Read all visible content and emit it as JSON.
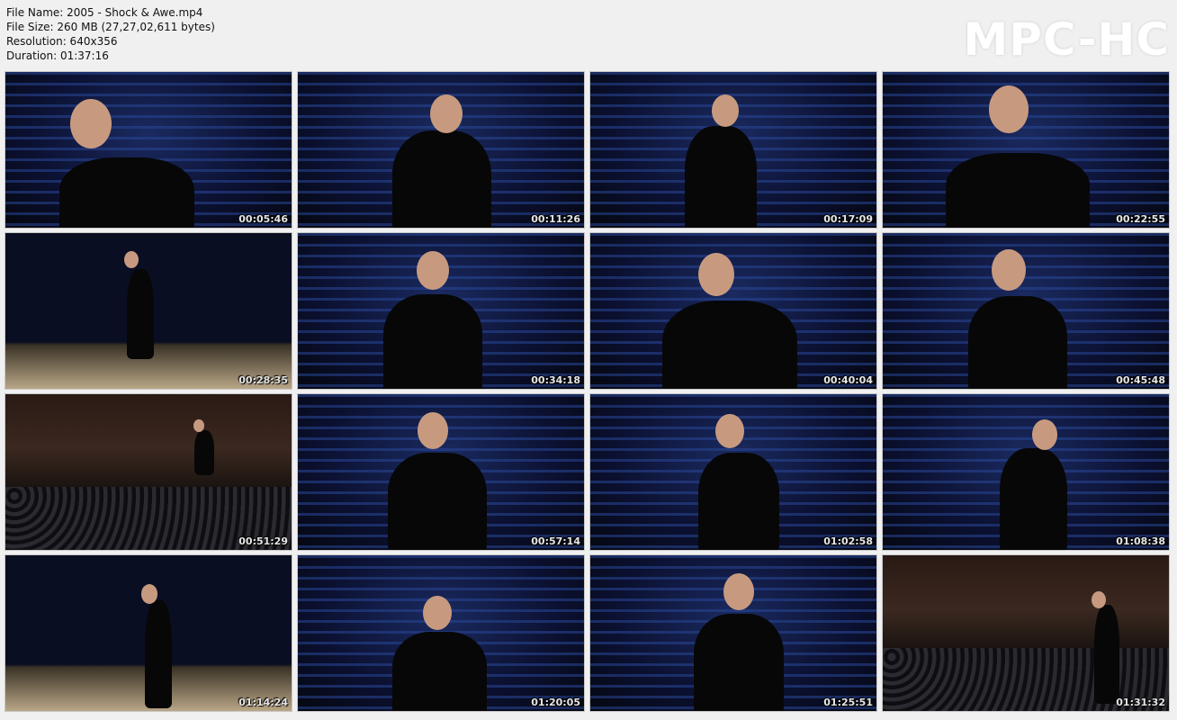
{
  "header": {
    "file_name": "File Name: 2005 - Shock & Awe.mp4",
    "file_size": "File Size: 260 MB (27,27,02,611 bytes)",
    "resolution": "Resolution: 640x356",
    "duration": "Duration: 01:37:16"
  },
  "logo": "MPC-HC",
  "thumbnails": [
    {
      "time": "00:05:46",
      "scene": "stripes"
    },
    {
      "time": "00:11:26",
      "scene": "stripes"
    },
    {
      "time": "00:17:09",
      "scene": "stripes"
    },
    {
      "time": "00:22:55",
      "scene": "stripes"
    },
    {
      "time": "00:28:35",
      "scene": "stage"
    },
    {
      "time": "00:34:18",
      "scene": "stripes"
    },
    {
      "time": "00:40:04",
      "scene": "stripes"
    },
    {
      "time": "00:45:48",
      "scene": "stripes"
    },
    {
      "time": "00:51:29",
      "scene": "hall"
    },
    {
      "time": "00:57:14",
      "scene": "stripes"
    },
    {
      "time": "01:02:58",
      "scene": "stripes"
    },
    {
      "time": "01:08:38",
      "scene": "stripes"
    },
    {
      "time": "01:14:24",
      "scene": "stage"
    },
    {
      "time": "01:20:05",
      "scene": "stripes"
    },
    {
      "time": "01:25:51",
      "scene": "stripes"
    },
    {
      "time": "01:31:32",
      "scene": "hall"
    }
  ]
}
